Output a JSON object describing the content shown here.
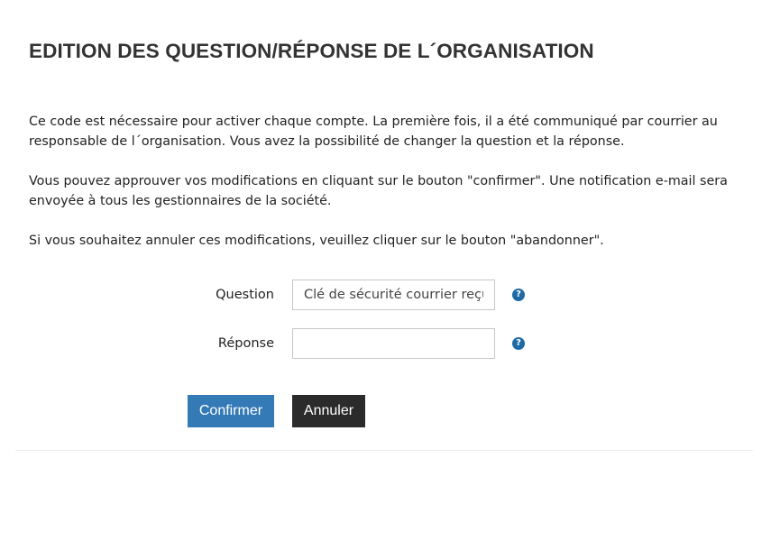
{
  "page": {
    "title": "EDITION DES QUESTION/RÉPONSE DE L´ORGANISATION"
  },
  "intro": {
    "paragraph1": "Ce code est nécessaire pour activer chaque compte. La première fois, il a été communiqué par courrier au responsable de l´organisation. Vous avez la possibilité de changer la question et la réponse.",
    "paragraph2": "Vous pouvez approuver vos modifications en cliquant sur le bouton \"confirmer\". Une notification e-mail sera envoyée à tous les gestionnaires de la société.",
    "paragraph3": "Si vous souhaitez annuler ces modifications, veuillez cliquer sur le bouton \"abandonner\"."
  },
  "form": {
    "question_label": "Question",
    "question_value": "Clé de sécurité courrier reçu",
    "reponse_label": "Réponse",
    "reponse_value": "",
    "help_glyph": "?",
    "help_icon": "question-circle-icon"
  },
  "buttons": {
    "confirm_label": "Confirmer",
    "cancel_label": "Annuler"
  },
  "colors": {
    "confirm_bg": "#337ab7",
    "cancel_bg": "#2b2b2b",
    "help_icon": "#1f6aa5"
  }
}
